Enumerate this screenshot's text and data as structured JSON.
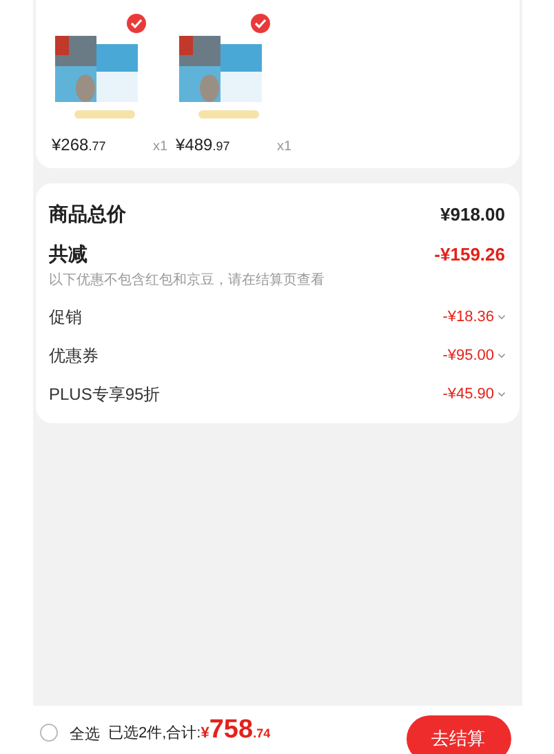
{
  "products": [
    {
      "kind": "picture",
      "selected": true,
      "price_main": "¥268",
      "price_cents": ".77",
      "quantity": "x1"
    },
    {
      "kind": "picture",
      "selected": true,
      "price_main": "¥489",
      "price_cents": ".97",
      "quantity": "x1"
    }
  ],
  "summary": {
    "total_label": "商品总价",
    "total_value": "¥918.00",
    "discount_label": "共减",
    "discount_value": "-¥159.26",
    "note": "以下优惠不包含红包和京豆，请在结算页查看",
    "rows": [
      {
        "label": "促销",
        "value": "-¥18.36"
      },
      {
        "label": "优惠券",
        "value": "-¥95.00"
      },
      {
        "label": "PLUS专享95折",
        "value": "-¥45.90"
      }
    ]
  },
  "footer": {
    "select_all": {
      "label": "全选",
      "checked": false
    },
    "selected_count": "已选2件,合计:",
    "currency": "¥",
    "amount_main": "758",
    "amount_cents": ".74",
    "checkout": "去结算"
  }
}
